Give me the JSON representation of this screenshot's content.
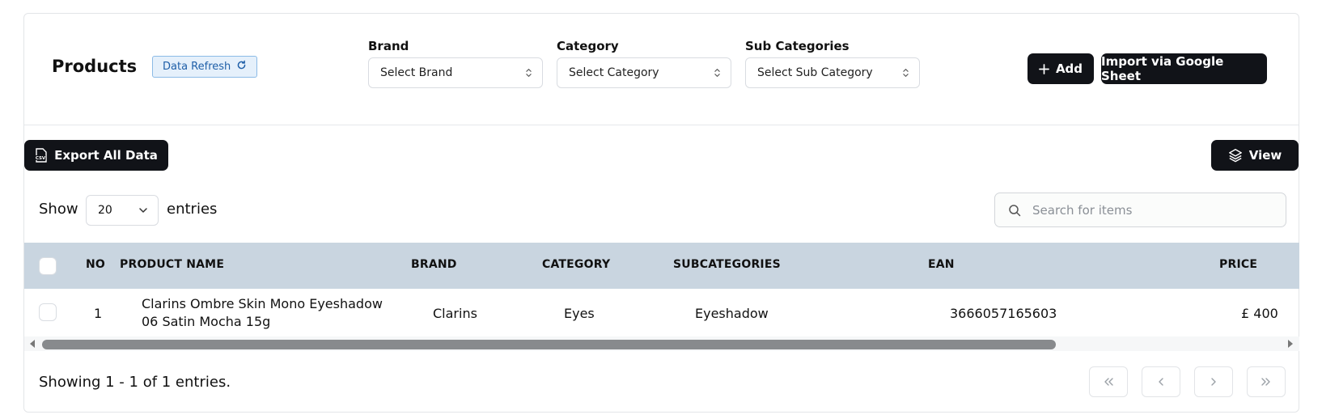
{
  "header": {
    "title": "Products",
    "refresh_label": "Data Refresh"
  },
  "filters": {
    "brand": {
      "label": "Brand",
      "placeholder": "Select Brand"
    },
    "category": {
      "label": "Category",
      "placeholder": "Select Category"
    },
    "subcategory": {
      "label": "Sub Categories",
      "placeholder": "Select Sub Category"
    }
  },
  "actions": {
    "add_label": "Add",
    "import_label": "Import via Google Sheet",
    "export_label": "Export All Data",
    "export_icon_text": "CSV",
    "view_label": "View"
  },
  "entries": {
    "show_label": "Show",
    "value": "20",
    "suffix": "entries"
  },
  "search": {
    "placeholder": "Search for items"
  },
  "table": {
    "columns": [
      "NO",
      "PRODUCT NAME",
      "BRAND",
      "CATEGORY",
      "SUBCATEGORIES",
      "EAN",
      "PRICE"
    ],
    "rows": [
      {
        "no": "1",
        "name_line1": "Clarins Ombre Skin Mono Eyeshadow",
        "name_line2": "06 Satin Mocha 15g",
        "brand": "Clarins",
        "category": "Eyes",
        "subcategory": "Eyeshadow",
        "ean": "3666057165603",
        "price": "£ 400"
      }
    ]
  },
  "footer": {
    "showing_text": "Showing 1 - 1 of 1 entries."
  },
  "icons": {
    "refresh": "refresh-icon",
    "select": "chevron-updown-icon",
    "add": "plus-icon",
    "export": "csv-file-icon",
    "view": "layers-icon",
    "search": "search-icon",
    "entries": "chevron-down-icon",
    "pagination": [
      "chevrons-left-icon",
      "chevron-left-icon",
      "chevron-right-icon",
      "chevrons-right-icon"
    ]
  },
  "colors": {
    "table_header_bg": "#c9d5e0",
    "dark_button": "#111318",
    "refresh_bg": "#e5f0fb",
    "refresh_text": "#1f5fa8",
    "scroll_thumb": "#888a8d"
  }
}
